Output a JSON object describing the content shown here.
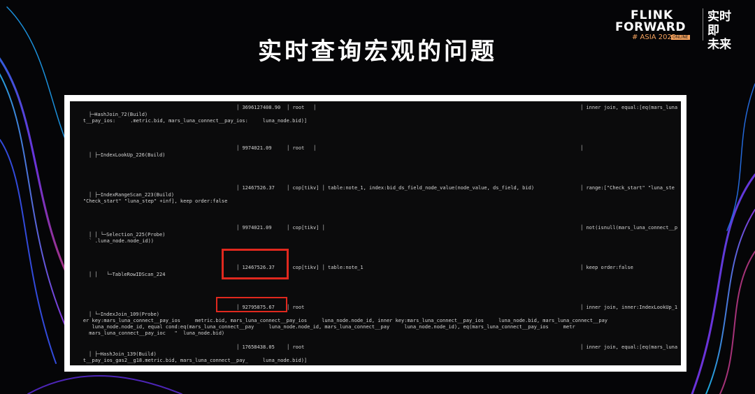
{
  "slide": {
    "title": "实时查询宏观的问题"
  },
  "logo": {
    "line1": "FLINK",
    "line2": "FORWARD",
    "line3": "# ASIA 2022",
    "badge": "ONLINE",
    "cn_line1": "实时即",
    "cn_line2": "未来"
  },
  "colors": {
    "title": "#ffffff",
    "panel_border": "#ffffff",
    "terminal_bg": "#0b0b0c",
    "highlight": "#e0281e",
    "logo_accent": "#f5a25d"
  },
  "plan_rows": [
    {
      "op": "├─HashJoin_72(Build)",
      "count": "3696127408.90",
      "task": "root",
      "access": "",
      "info": "inner join, equal:[eq(mars_luna"
    },
    {
      "op": "t__pay_ios:     .metric.bid, mars_luna_connect__pay_ios:     luna_node.bid)]",
      "count": "",
      "task": "",
      "access": "",
      "info": ""
    },
    {
      "op": "│ ├─IndexLookUp_226(Build)",
      "count": "9974021.09",
      "task": "root",
      "access": "",
      "info": ""
    },
    {
      "op": "│ ├─IndexRangeScan_223(Build)",
      "count": "12467526.37",
      "task": "cop[tikv]",
      "access": "table:note_1, index:bid_ds_field_node_value(node_value, ds_field, bid)",
      "info": "range:[\"Check_start\" \"luna_ste"
    },
    {
      "op": "\"Check_start\" \"luna_step\" +inf], keep order:false",
      "count": "",
      "task": "",
      "access": "",
      "info": ""
    },
    {
      "op": "│ │ └─Selection_225(Probe)",
      "count": "9974021.09",
      "task": "cop[tikv]",
      "access": "",
      "info": "not(isnull(mars_luna_connect__p"
    },
    {
      "op": "  ` .luna_node.node_id))",
      "count": "",
      "task": "",
      "access": "",
      "info": ""
    },
    {
      "op": "│ │   └─TableRowIDScan_224",
      "count": "12467526.37",
      "task": "cop[tikv]",
      "access": "table:note_1",
      "info": "keep order:false"
    },
    {
      "op": "│ └─IndexJoin_109(Probe)",
      "count": "92795875.67",
      "task": "root",
      "access": "",
      "info": "inner join, inner:IndexLookUp_1"
    },
    {
      "op": "er key:mars_luna_connect__pay_ios     metric.bid, mars_luna_connect__pay_ios     luna_node.node_id, inner key:mars_luna_connect__pay_ios     luna_node.bid, mars_luna_connect__pay",
      "count": "",
      "task": "",
      "access": "",
      "info": ""
    },
    {
      "op": "   luna_node.node_id, equal cond:eq(mars_luna_connect__pay     luna_node.node_id, mars_luna_connect__pay     luna_node.node_id), eq(mars_luna_connect__pay_ios     metr",
      "count": "",
      "task": "",
      "access": "",
      "info": ""
    },
    {
      "op": "  mars_luna_connect__pay_ioc   \"  luna_node.bid)",
      "count": "",
      "task": "",
      "access": "",
      "info": ""
    },
    {
      "op": "│ ├─HashJoin_139(Build)",
      "count": "17658438.05",
      "task": "root",
      "access": "",
      "info": "inner join, equal:[eq(mars_luna"
    },
    {
      "op": "t__pay_ios_gas2__g18.metric.bid, mars_luna_connect__pay_     luna_node.bid)]",
      "count": "",
      "task": "",
      "access": "",
      "info": ""
    }
  ]
}
